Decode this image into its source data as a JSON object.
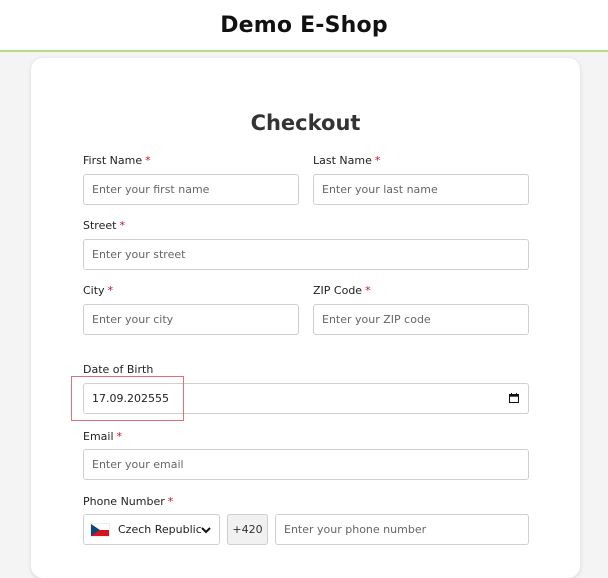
{
  "header": {
    "title": "Demo E-Shop"
  },
  "checkout": {
    "title": "Checkout",
    "required_mark": "*",
    "first_name": {
      "label": "First Name",
      "placeholder": "Enter your first name"
    },
    "last_name": {
      "label": "Last Name",
      "placeholder": "Enter your last name"
    },
    "street": {
      "label": "Street",
      "placeholder": "Enter your street"
    },
    "city": {
      "label": "City",
      "placeholder": "Enter your city"
    },
    "zip": {
      "label": "ZIP Code",
      "placeholder": "Enter your ZIP code"
    },
    "dob": {
      "label": "Date of Birth",
      "value": "17.09.202555"
    },
    "email": {
      "label": "Email",
      "placeholder": "Enter your email"
    },
    "phone": {
      "label": "Phone Number",
      "country": "Czech Republic",
      "prefix": "+420",
      "placeholder": "Enter your phone number"
    }
  },
  "icons": {
    "calendar": "calendar-icon",
    "dropdown": "chevron-down-icon",
    "flag": "czech-flag-icon"
  },
  "colors": {
    "accent_border": "#b5dd84",
    "required": "#c8102e",
    "highlight": "#e0717a"
  }
}
